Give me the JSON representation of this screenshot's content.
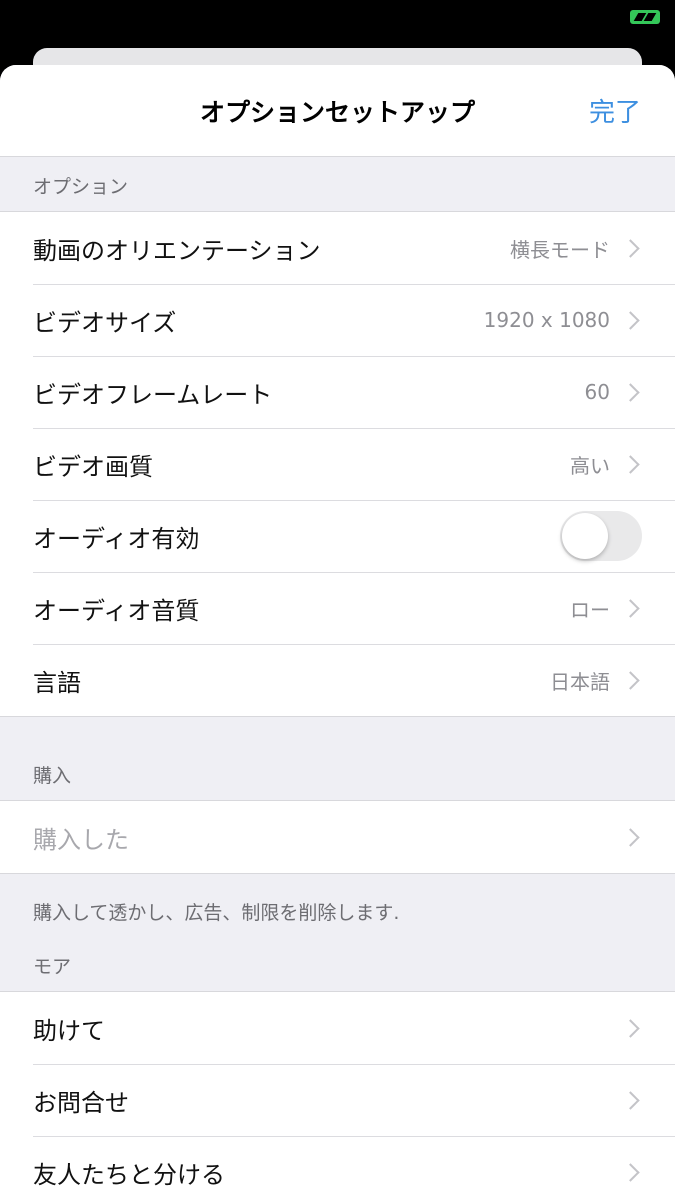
{
  "nav": {
    "title": "オプションセットアップ",
    "done_label": "完了"
  },
  "sections": {
    "options": {
      "header": "オプション",
      "rows": [
        {
          "label": "動画のオリエンテーション",
          "value": "横長モード"
        },
        {
          "label": "ビデオサイズ",
          "value": "1920 x 1080"
        },
        {
          "label": "ビデオフレームレート",
          "value": "60"
        },
        {
          "label": "ビデオ画質",
          "value": "高い"
        },
        {
          "label": "オーディオ有効",
          "toggle_on": false
        },
        {
          "label": "オーディオ音質",
          "value": "ロー"
        },
        {
          "label": "言語",
          "value": "日本語"
        }
      ]
    },
    "purchase": {
      "header": "購入",
      "rows": [
        {
          "label": "購入した"
        }
      ],
      "footer": "購入して透かし、広告、制限を削除します."
    },
    "more": {
      "header": "モア",
      "rows": [
        {
          "label": "助けて"
        },
        {
          "label": "お問合せ"
        },
        {
          "label": "友人たちと分ける"
        }
      ]
    }
  },
  "colors": {
    "accent": "#3d8fe0",
    "toggle_off": "#e9e9ea",
    "background": "#efeff4"
  },
  "icons": {
    "chevron": "chevron-right-icon",
    "status": "battery-charging-icon"
  }
}
